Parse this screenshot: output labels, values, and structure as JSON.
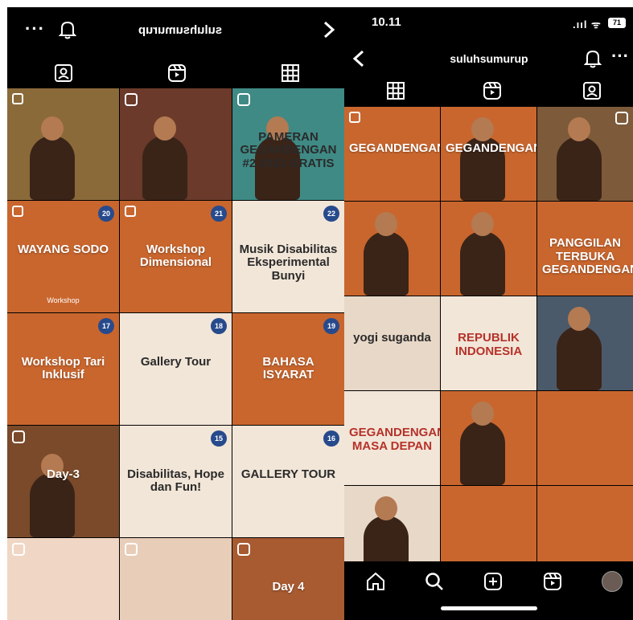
{
  "left": {
    "username": "suluhsumurup",
    "left_grid": [
      {
        "label": "",
        "bg": "#8b6a3a",
        "style": "photo",
        "icon": "multi"
      },
      {
        "label": "",
        "bg": "#6b3a2a",
        "style": "photo",
        "icon": "reel"
      },
      {
        "label": "PAMERAN GEGANDENGAN #2 2023 GRATIS",
        "bg": "#3f8a85",
        "style": "photo",
        "icon": "reel",
        "dark": true
      },
      {
        "label": "WAYANG SODO",
        "bg": "#c9662e",
        "badge": "20",
        "sub": "Workshop",
        "icon": "multi"
      },
      {
        "label": "Workshop Dimensional",
        "bg": "#c9662e",
        "badge": "21",
        "icon": "multi"
      },
      {
        "label": "Musik Disabilitas Eksperimental Bunyi",
        "bg": "#f2e6d8",
        "badge": "22",
        "dark": true
      },
      {
        "label": "Workshop Tari Inklusif",
        "bg": "#c9662e",
        "badge": "17"
      },
      {
        "label": "Gallery Tour",
        "bg": "#f2e6d8",
        "badge": "18",
        "dark": true
      },
      {
        "label": "BAHASA ISYARAT",
        "bg": "#c9662e",
        "badge": "19"
      },
      {
        "label": "Day-3",
        "bg": "#7a4a2a",
        "style": "photo",
        "icon": "reel"
      },
      {
        "label": "Disabilitas, Hope dan Fun!",
        "bg": "#f2e6d8",
        "badge": "15",
        "dark": true
      },
      {
        "label": "GALLERY TOUR",
        "bg": "#f2e6d8",
        "badge": "16",
        "dark": true
      },
      {
        "label": "",
        "bg": "#f0d6c4",
        "icon": "reel"
      },
      {
        "label": "",
        "bg": "#e8cdb8",
        "icon": "reel"
      },
      {
        "label": "Day 4",
        "bg": "#a85a30",
        "icon": "reel"
      }
    ]
  },
  "right": {
    "time": "10.11",
    "signal": ".ııl ᯤ",
    "battery": "71",
    "username": "suluhsumurup",
    "right_grid": [
      {
        "label": "GEGANDENGAN",
        "bg": "#c9662e",
        "icon": "multi"
      },
      {
        "label": "GEGANDENGAN",
        "bg": "#c9662e",
        "style": "photo"
      },
      {
        "label": "",
        "bg": "#7d5a3a",
        "style": "photo",
        "icon": "reel"
      },
      {
        "label": "",
        "bg": "#c9662e",
        "style": "photo"
      },
      {
        "label": "",
        "bg": "#c9662e",
        "style": "photo"
      },
      {
        "label": "PANGGILAN TERBUKA GEGANDENGAN",
        "bg": "#c9662e"
      },
      {
        "label": "yogi suganda",
        "bg": "#e8d8c8",
        "dark": true
      },
      {
        "label": "REPUBLIK INDONESIA",
        "bg": "#f2e6d8",
        "stamp": true
      },
      {
        "label": "",
        "bg": "#4a5a6a",
        "style": "photo"
      },
      {
        "label": "GEGANDENGAN MASA DEPAN",
        "bg": "#f2e6d8",
        "stamp": true
      },
      {
        "label": "",
        "bg": "#c9662e",
        "style": "photo"
      },
      {
        "label": "",
        "bg": "#c9662e"
      },
      {
        "label": "",
        "bg": "#e8d8c8",
        "style": "photo"
      },
      {
        "label": "",
        "bg": "#c9662e"
      },
      {
        "label": "",
        "bg": "#c9662e"
      }
    ]
  }
}
